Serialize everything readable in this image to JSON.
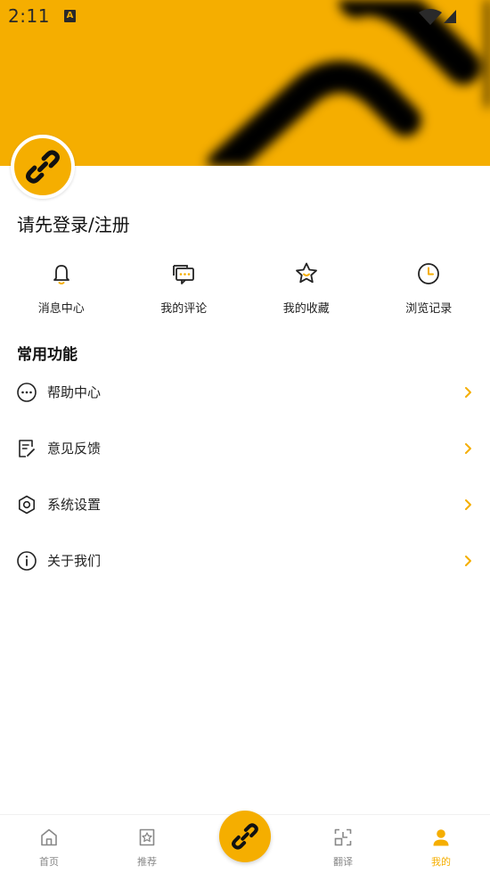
{
  "statusbar": {
    "time": "2:11",
    "indicator": "A"
  },
  "profile": {
    "login_text": "请先登录/注册"
  },
  "quick_actions": [
    {
      "label": "消息中心",
      "icon": "bell-icon"
    },
    {
      "label": "我的评论",
      "icon": "comment-icon"
    },
    {
      "label": "我的收藏",
      "icon": "star-icon"
    },
    {
      "label": "浏览记录",
      "icon": "clock-icon"
    }
  ],
  "section": {
    "title": "常用功能"
  },
  "menu": [
    {
      "label": "帮助中心",
      "icon": "help-icon"
    },
    {
      "label": "意见反馈",
      "icon": "feedback-icon"
    },
    {
      "label": "系统设置",
      "icon": "settings-icon"
    },
    {
      "label": "关于我们",
      "icon": "info-icon"
    }
  ],
  "nav": [
    {
      "label": "首页",
      "icon": "home-icon"
    },
    {
      "label": "推荐",
      "icon": "recommend-icon"
    },
    {
      "label": "翻译",
      "icon": "translate-icon"
    },
    {
      "label": "我的",
      "icon": "person-icon",
      "active": true
    }
  ],
  "colors": {
    "accent": "#f5ae00",
    "text": "#222222",
    "muted": "#888888"
  }
}
